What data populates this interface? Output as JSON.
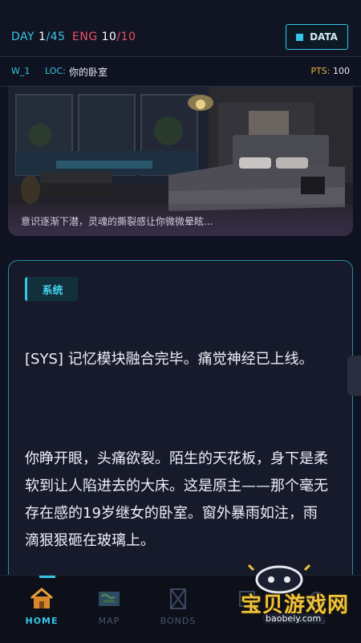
{
  "topbar": {
    "day_label": "DAY",
    "day_current": "1",
    "day_total": "/45",
    "eng_label": "ENG",
    "eng_current": "10",
    "eng_total": "/10",
    "data_button": "DATA"
  },
  "subbar": {
    "world": "W_1",
    "loc_label": "LOC:",
    "loc_value": "你的卧室",
    "pts_label": "PTS:",
    "pts_value": "100"
  },
  "scene": {
    "caption": "意识逐渐下潜，灵魂的撕裂感让你微微晕眩..."
  },
  "story": {
    "tag": "系统",
    "paragraphs": [
      "[SYS] 记忆模块融合完毕。痛觉神经已上线。",
      "你睁开眼，头痛欲裂。陌生的天花板，身下是柔软到让人陷进去的大床。这是原主——那个毫无存在感的19岁继女的卧室。窗外暴雨如注，雨滴狠狠砸在玻璃上。"
    ]
  },
  "nav": {
    "items": [
      {
        "label": "HOME",
        "icon": "home-icon"
      },
      {
        "label": "MAP",
        "icon": "map-icon"
      },
      {
        "label": "BONDS",
        "icon": "bonds-icon"
      },
      {
        "label": "",
        "icon": "item-icon"
      },
      {
        "label": "SYS",
        "icon": "sys-icon"
      }
    ]
  },
  "watermark": {
    "text": "宝贝游戏网",
    "url": "baobeiy.com"
  },
  "colors": {
    "accent": "#35c6e6",
    "danger": "#ef4e64",
    "points": "#e3b341",
    "background": "#0f1220"
  }
}
